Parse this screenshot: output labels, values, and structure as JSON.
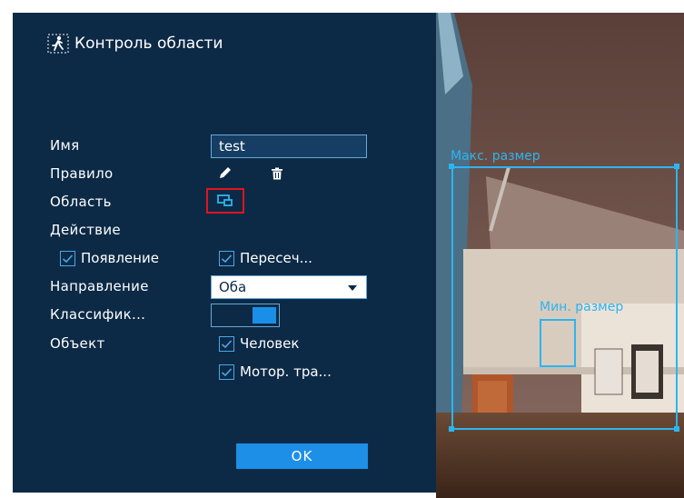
{
  "panel": {
    "title": "Контроль области",
    "fields": {
      "name_label": "Имя",
      "name_value": "test",
      "rule_label": "Правило",
      "region_label": "Область",
      "action_label": "Действие",
      "action_appear": "Появление",
      "action_cross": "Пересеч...",
      "direction_label": "Направление",
      "direction_value": "Оба",
      "classify_label": "Классифик...",
      "object_label": "Объект",
      "object_human": "Человек",
      "object_vehicle": "Мотор. тра..."
    },
    "ok_label": "OK",
    "icons": {
      "title": "person-running-icon",
      "edit": "pencil-icon",
      "delete": "trash-icon",
      "region": "region-draw-icon"
    }
  },
  "video": {
    "max_label": "Макс. размер",
    "min_label": "Мин. размер"
  },
  "colors": {
    "panel_bg": "#0c2a46",
    "accent": "#1e8fe6",
    "overlay": "#2db4f0",
    "highlight": "#e0141d"
  }
}
